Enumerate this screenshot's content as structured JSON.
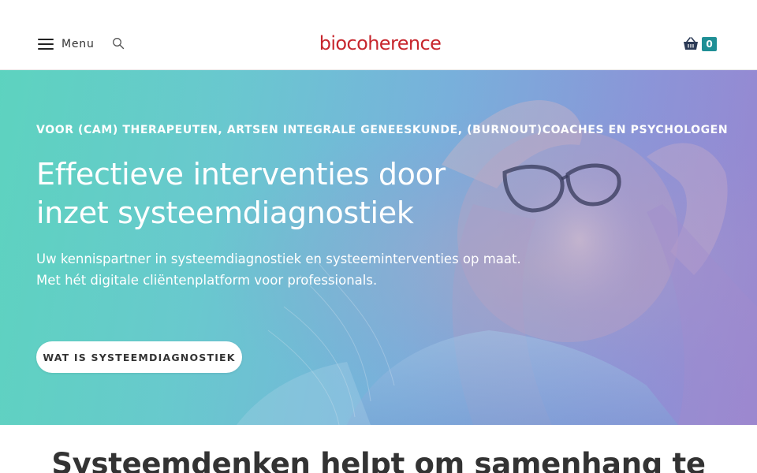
{
  "header": {
    "menu_label": "Menu",
    "logo_text": "biocoherence",
    "cart_count": "0",
    "icons": [
      "hamburger-icon",
      "search-icon",
      "basket-icon"
    ],
    "brand_color": "#c7262d",
    "accent_color": "#1f8f95"
  },
  "hero": {
    "kicker": "VOOR (CAM) THERAPEUTEN, ARTSEN INTEGRALE GENEESKUNDE, (BURNOUT)COACHES EN PSYCHOLOGEN",
    "headline_line1": "Effectieve interventies door",
    "headline_line2": "inzet systeemdiagnostiek",
    "sub_line1": "Uw kennispartner in systeemdiagnostiek en systeeminterventies op maat.",
    "sub_line2": "Met hét digitale cliëntenplatform voor professionals.",
    "cta_label": "WAT IS SYSTEEMDIAGNOSTIEK"
  },
  "section": {
    "title": "Systeemdenken helpt om samenhang te"
  }
}
